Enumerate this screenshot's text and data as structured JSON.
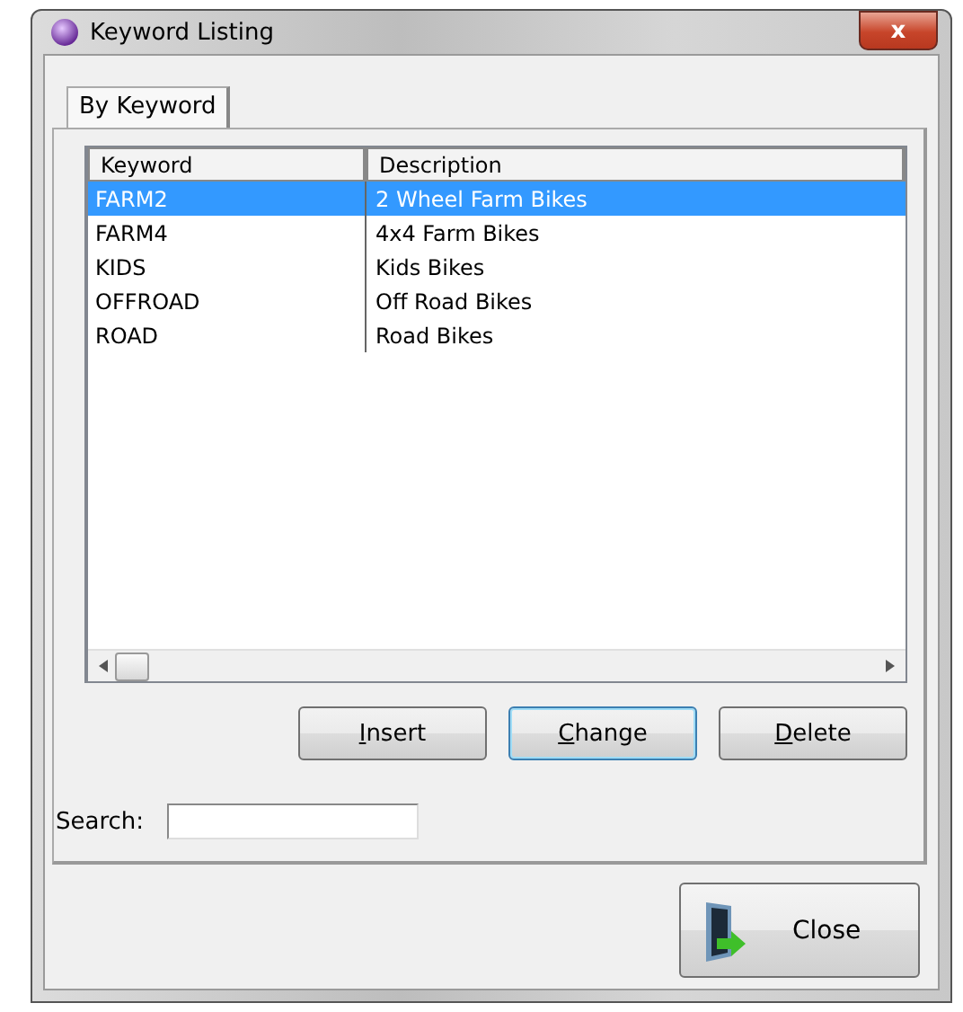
{
  "window": {
    "title": "Keyword Listing",
    "close_glyph": "x"
  },
  "tabs": [
    {
      "label": "By Keyword",
      "selected": true
    }
  ],
  "table": {
    "columns": [
      "Keyword",
      "Description"
    ],
    "rows": [
      {
        "cells": [
          "FARM2",
          "2 Wheel Farm Bikes"
        ],
        "selected": true
      },
      {
        "cells": [
          "FARM4",
          "4x4 Farm Bikes"
        ],
        "selected": false
      },
      {
        "cells": [
          "KIDS",
          "Kids Bikes"
        ],
        "selected": false
      },
      {
        "cells": [
          "OFFROAD",
          "Off Road Bikes"
        ],
        "selected": false
      },
      {
        "cells": [
          "ROAD",
          "Road Bikes"
        ],
        "selected": false
      }
    ]
  },
  "buttons": [
    {
      "label": "Insert",
      "underline_first": true,
      "focused": false
    },
    {
      "label": "Change",
      "underline_first": true,
      "focused": true
    },
    {
      "label": "Delete",
      "underline_first": true,
      "focused": false
    }
  ],
  "search": {
    "label": "Search:"
  },
  "close_button": {
    "label": "Close"
  }
}
